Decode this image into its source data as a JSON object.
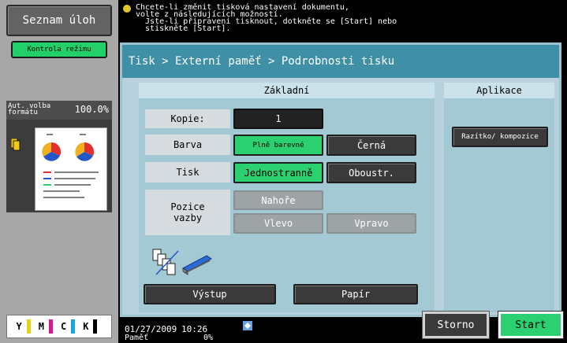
{
  "left": {
    "job_list_label": "Seznam úloh",
    "check_mode_label": "Kontrola režimu",
    "auto_format_label": "Aut. volba formátu",
    "zoom": "100.0%",
    "toner_labels": [
      "Y",
      "M",
      "C",
      "K"
    ],
    "toner_colors": [
      "#e8d31a",
      "#d11a8f",
      "#19a6d8",
      "#000000"
    ]
  },
  "message": {
    "lines": [
      "Chcete-li změnit tisková nastavení dokumentu,",
      "volte z následujících možností.",
      "  Jste-li připraveni tisknout, dotkněte se [Start] nebo",
      "  stiskněte [Start]."
    ]
  },
  "breadcrumb": "Tisk > Externí paměť > Podrobnosti tisku",
  "basic": {
    "header": "Základní",
    "copies_label": "Kopie:",
    "copies_value": "1",
    "color_label": "Barva",
    "color_full": "Plně barevné",
    "color_black": "Černá",
    "print_label": "Tisk",
    "print_simplex": "Jednostranně",
    "print_duplex": "Oboustr.",
    "binding_label": "Pozice vazby",
    "binding_top": "Nahoře",
    "binding_left": "Vlevo",
    "binding_right": "Vpravo",
    "output_label": "Výstup",
    "paper_label": "Papír"
  },
  "apps": {
    "header": "Aplikace",
    "stamp_label": "Razítko/ kompozice"
  },
  "status": {
    "date": "01/27/2009",
    "time": "10:26",
    "memory_label": "Paměť",
    "memory_value": "0%"
  },
  "actions": {
    "cancel_label": "Storno",
    "start_label": "Start"
  },
  "colors": {
    "accent_green": "#2bd071",
    "header_blue": "#3f8fa6",
    "panel_blue": "#b7d2dc"
  }
}
